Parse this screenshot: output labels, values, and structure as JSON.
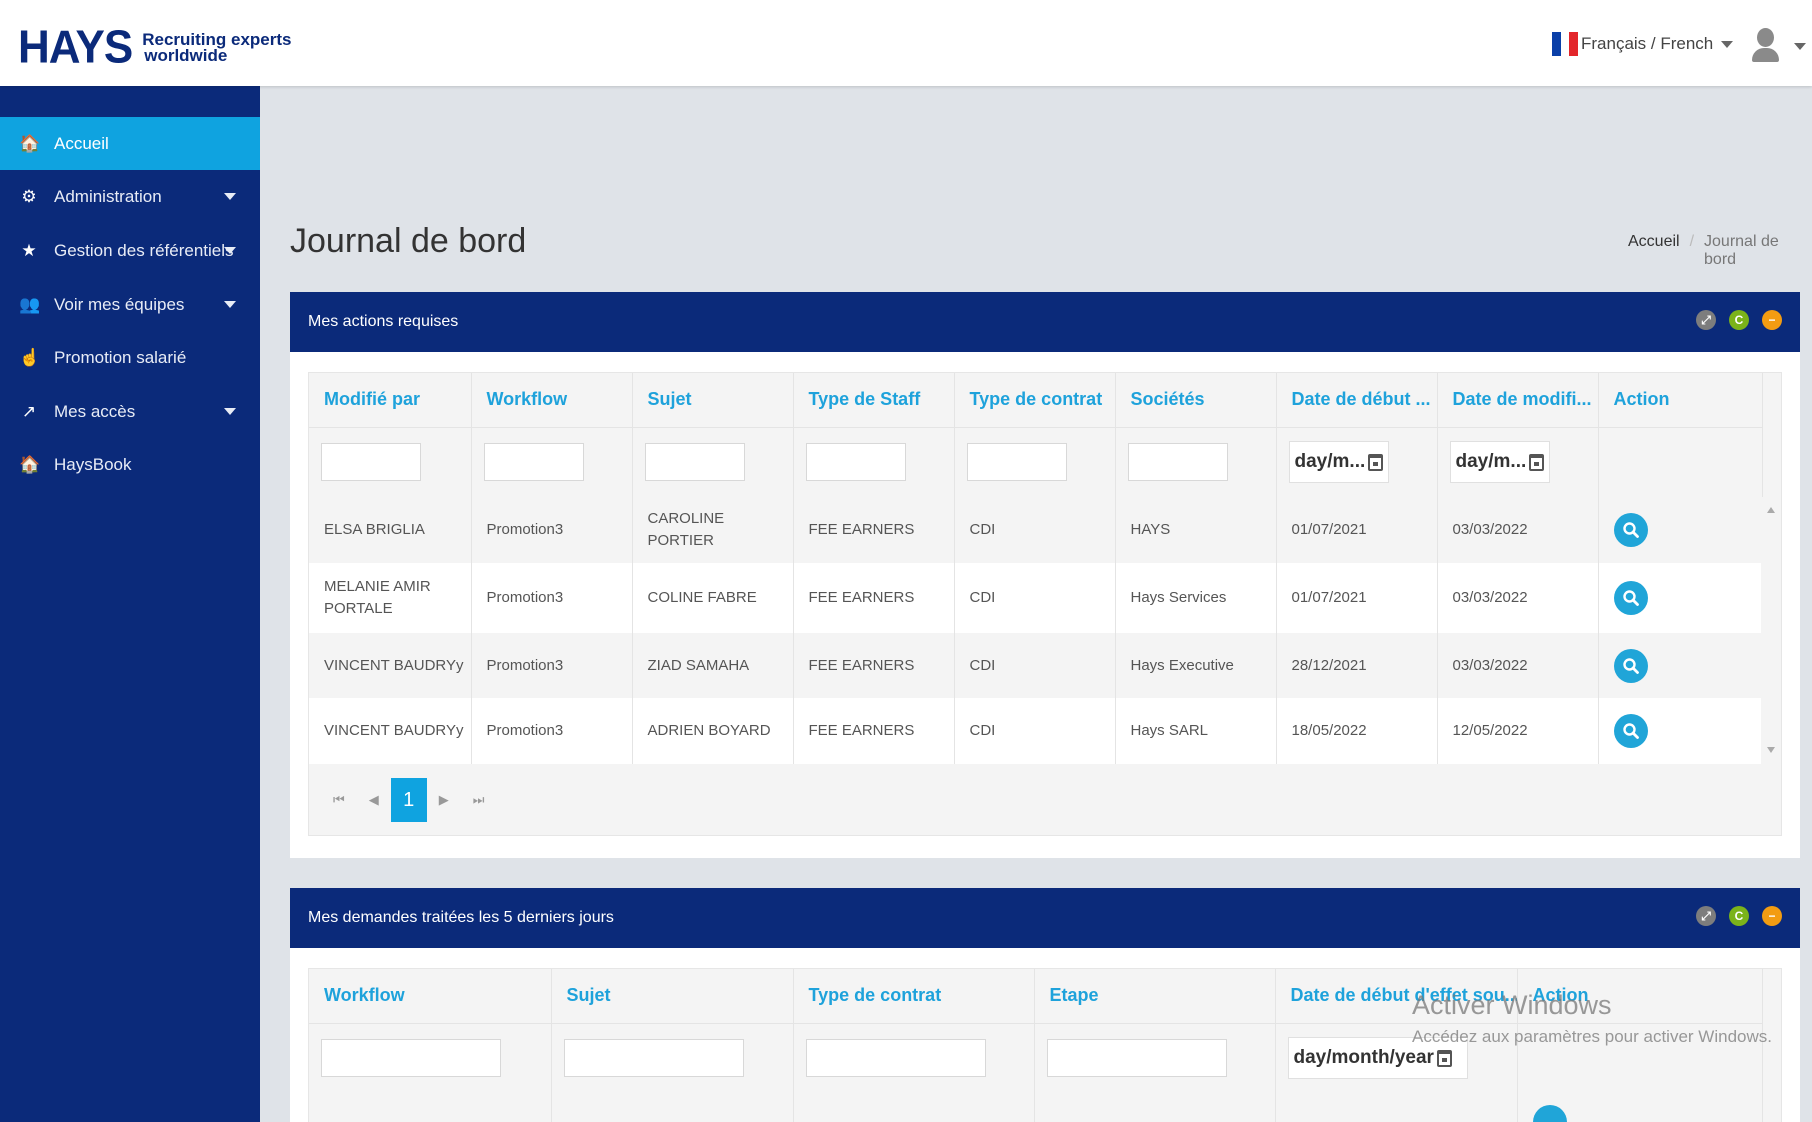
{
  "brand": {
    "name": "HAYS",
    "tagline_1": "Recruiting experts",
    "tagline_2": "worldwide"
  },
  "header": {
    "language": "Français / French",
    "flag_colors": [
      "#0a3fa8",
      "#ffffff",
      "#e3262b"
    ],
    "user_icon": "user-icon"
  },
  "sidebar": {
    "items": [
      {
        "label": "Accueil",
        "icon": "home-icon",
        "glyph": "🏠"
      },
      {
        "label": "Administration",
        "icon": "cogs-icon",
        "glyph": "⚙"
      },
      {
        "label": "Gestion des référentiels",
        "icon": "star-icon",
        "glyph": "★"
      },
      {
        "label": "Voir mes équipes",
        "icon": "users-icon",
        "glyph": "👥"
      },
      {
        "label": "Promotion salarié",
        "icon": "hand-pointer-icon",
        "glyph": "☝"
      },
      {
        "label": "Mes accès",
        "icon": "external-link-icon",
        "glyph": "↗"
      },
      {
        "label": "HaysBook",
        "icon": "home-icon",
        "glyph": "🏠"
      }
    ]
  },
  "page": {
    "title": "Journal de bord",
    "breadcrumb": [
      "Accueil",
      "Journal de bord"
    ]
  },
  "panel1": {
    "title": "Mes actions requises",
    "tools": {
      "expand": "⤢",
      "refresh": "C",
      "collapse": "−"
    },
    "columns": [
      "Modifié par",
      "Workflow",
      "Sujet",
      "Type de Staff",
      "Type de contrat",
      "Sociétés",
      "Date de début ...",
      "Date de modifi...",
      "Action"
    ],
    "date_placeholder": "day/m...",
    "rows": [
      [
        "ELSA BRIGLIA",
        "Promotion3",
        "CAROLINE PORTIER",
        "FEE EARNERS",
        "CDI",
        "HAYS",
        "01/07/2021",
        "03/03/2022"
      ],
      [
        "MELANIE AMIR PORTALE",
        "Promotion3",
        "COLINE FABRE",
        "FEE EARNERS",
        "CDI",
        "Hays Services",
        "01/07/2021",
        "03/03/2022"
      ],
      [
        "VINCENT BAUDRYy",
        "Promotion3",
        "ZIAD SAMAHA",
        "FEE EARNERS",
        "CDI",
        "Hays Executive",
        "28/12/2021",
        "03/03/2022"
      ],
      [
        "VINCENT BAUDRYy",
        "Promotion3",
        "ADRIEN BOYARD",
        "FEE EARNERS",
        "CDI",
        "Hays SARL",
        "18/05/2022",
        "12/05/2022"
      ]
    ],
    "pager": {
      "first": "⏮",
      "prev": "◀",
      "page": "1",
      "next": "▶",
      "last": "⏭"
    }
  },
  "panel2": {
    "title": "Mes demandes traitées les 5 derniers jours",
    "tools": {
      "expand": "⤢",
      "refresh": "C",
      "collapse": "−"
    },
    "columns": [
      "Workflow",
      "Sujet",
      "Type de contrat",
      "Etape",
      "Date de début d'effet sou...",
      "Action"
    ],
    "date_placeholder": "day/month/year"
  },
  "watermark": {
    "title": "Activer Windows",
    "subtitle": "Accédez aux paramètres pour activer Windows."
  },
  "colors": {
    "navy": "#0b2a7a",
    "accent": "#0fa3e0",
    "link": "#1ea2db"
  }
}
